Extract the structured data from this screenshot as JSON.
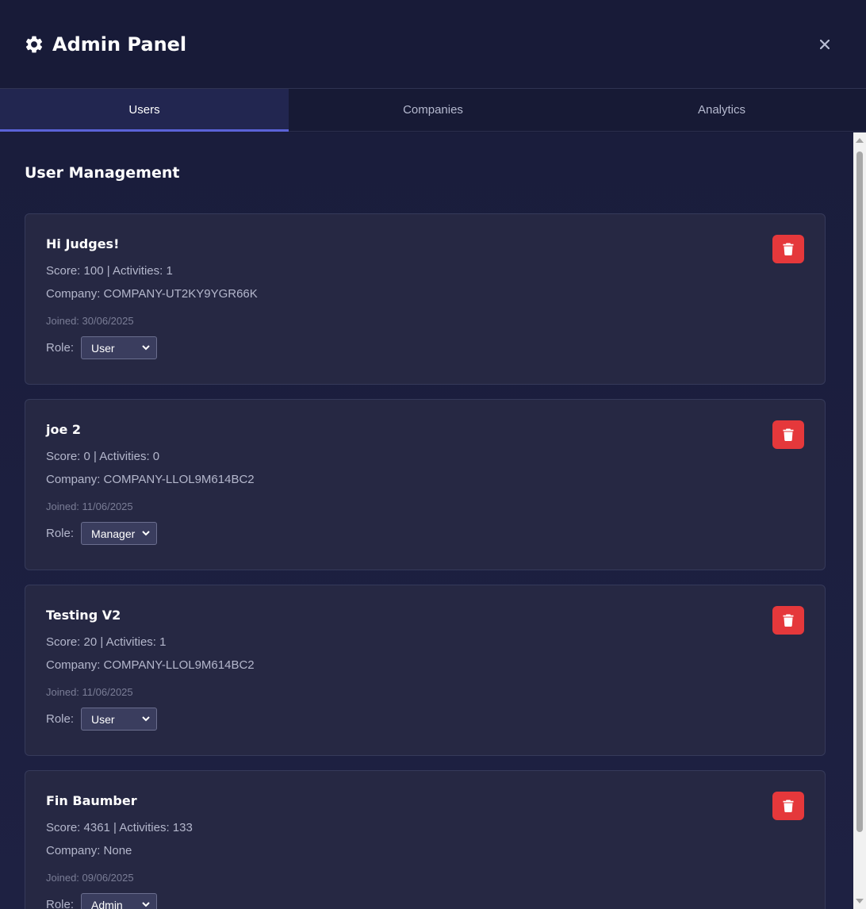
{
  "header": {
    "title": "Admin Panel",
    "icon": "gear-icon",
    "close_icon": "close-icon"
  },
  "tabs": [
    {
      "label": "Users",
      "active": true
    },
    {
      "label": "Companies",
      "active": false
    },
    {
      "label": "Analytics",
      "active": false
    }
  ],
  "main": {
    "section_title": "User Management",
    "role_label": "Role:"
  },
  "users": [
    {
      "name": "Hi Judges!",
      "stats": "Score: 100 | Activities: 1",
      "company": "Company: COMPANY-UT2KY9YGR66K",
      "joined": "Joined: 30/06/2025",
      "role": "User"
    },
    {
      "name": "joe 2",
      "stats": "Score: 0 | Activities: 0",
      "company": "Company: COMPANY-LLOL9M614BC2",
      "joined": "Joined: 11/06/2025",
      "role": "Manager"
    },
    {
      "name": "Testing V2",
      "stats": "Score: 20 | Activities: 1",
      "company": "Company: COMPANY-LLOL9M614BC2",
      "joined": "Joined: 11/06/2025",
      "role": "User"
    },
    {
      "name": "Fin Baumber",
      "stats": "Score: 4361 | Activities: 133",
      "company": "Company: None",
      "joined": "Joined: 09/06/2025",
      "role": "Admin"
    }
  ],
  "colors": {
    "background": "#181b38",
    "card": "#262843",
    "accent": "#5b63d8",
    "danger": "#e5383b"
  }
}
